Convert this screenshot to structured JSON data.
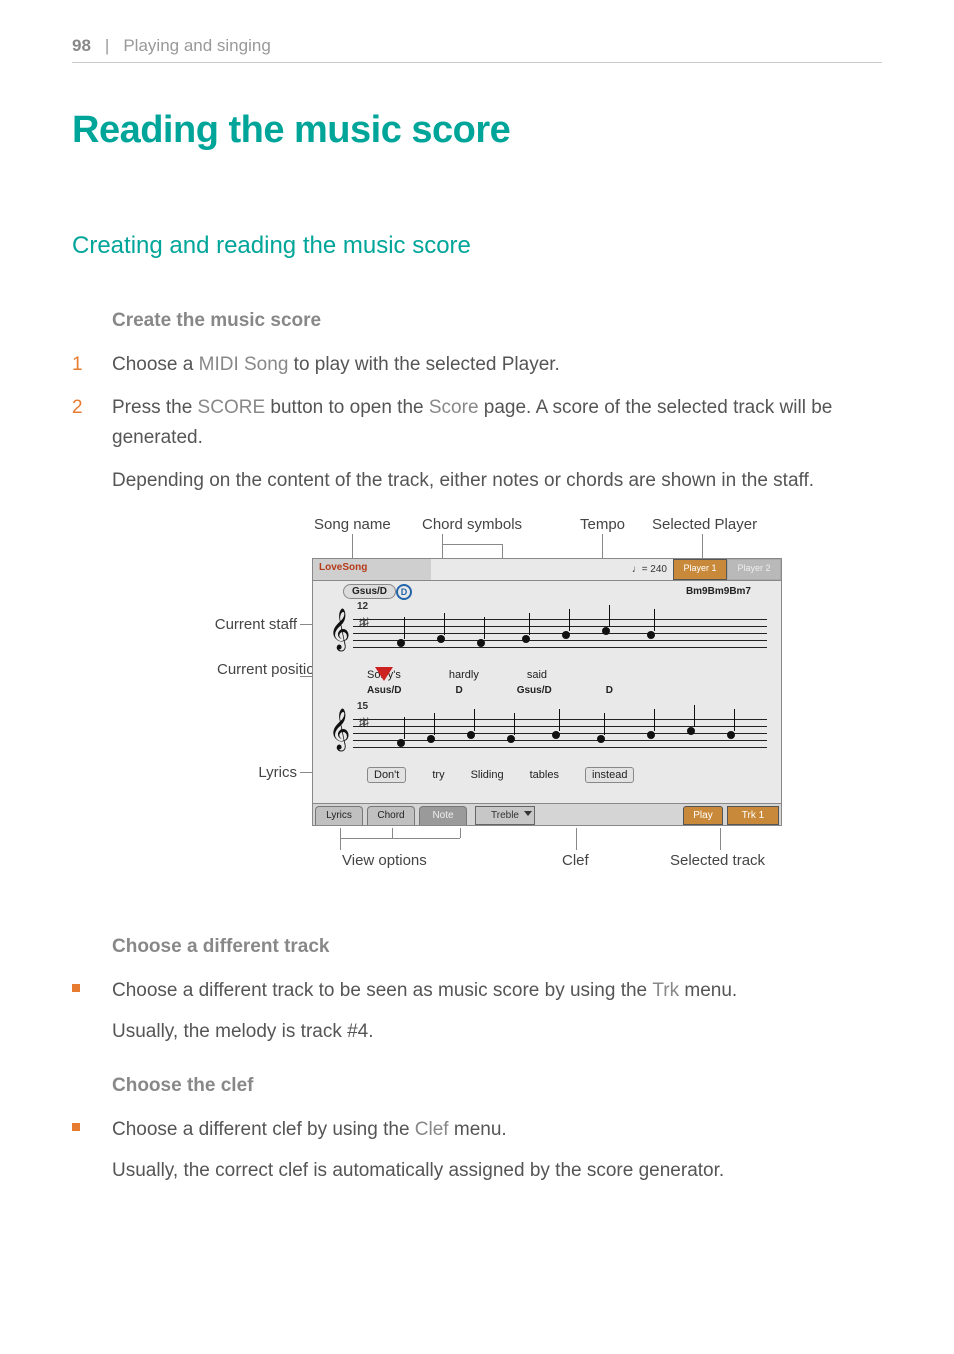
{
  "header": {
    "page_number": "98",
    "section": "Playing and singing"
  },
  "h1": "Reading the music score",
  "h2": "Creating and reading the music score",
  "h3_create": "Create the music score",
  "step1": {
    "num": "1",
    "pre": "Choose a ",
    "term": "MIDI Song",
    "post": " to play with the selected Player."
  },
  "step2": {
    "num": "2",
    "pre": "Press the ",
    "term1": "SCORE",
    "mid": " button to open the ",
    "term2": "Score",
    "post": " page. A score of the selected track will be generated."
  },
  "para_depending": "Depending on the content of the track, either notes or chords are shown in the staff.",
  "callouts": {
    "song_name": "Song name",
    "chord_symbols": "Chord symbols",
    "tempo": "Tempo",
    "selected_player": "Selected Player",
    "current_staff": "Current staff",
    "current_position": "Current position",
    "lyrics": "Lyrics",
    "view_options": "View options",
    "clef": "Clef",
    "selected_track": "Selected track"
  },
  "panel": {
    "song_name": "LoveSong",
    "tempo": "♩= 240",
    "player1": "Player 1",
    "player2": "Player 2",
    "chords_top": {
      "c1": "Gsus/D",
      "d_mark": "D",
      "c2": "Bm9",
      "c3": "Bm9",
      "c4": "Bm7"
    },
    "bar1": "12",
    "lyrics1": {
      "w1": "Sorry's",
      "w2": "hardly",
      "w3": "said"
    },
    "chords_mid": {
      "c1": "Asus/D",
      "c2": "D",
      "c3": "Gsus/D",
      "c4": "D"
    },
    "bar2": "15",
    "lyrics2": {
      "w1": "Don't",
      "w2": "try",
      "w3": "Sliding",
      "w4": "tables",
      "w5": "instead"
    },
    "bottom": {
      "lyrics_btn": "Lyrics",
      "chord_btn": "Chord",
      "note_btn": "Note",
      "clef_drop": "Treble",
      "play_btn": "Play",
      "trk_drop": "Trk 1"
    }
  },
  "h3_track": "Choose a different track",
  "bullet_track": {
    "pre": "Choose a different track to be seen as music score by using the ",
    "term": "Trk",
    "post": " menu."
  },
  "track_note": "Usually, the melody is track #4.",
  "h3_clef": "Choose the clef",
  "bullet_clef": {
    "pre": "Choose a different clef by using the ",
    "term": "Clef",
    "post": " menu."
  },
  "clef_note": "Usually, the correct clef is automatically assigned by the score generator."
}
